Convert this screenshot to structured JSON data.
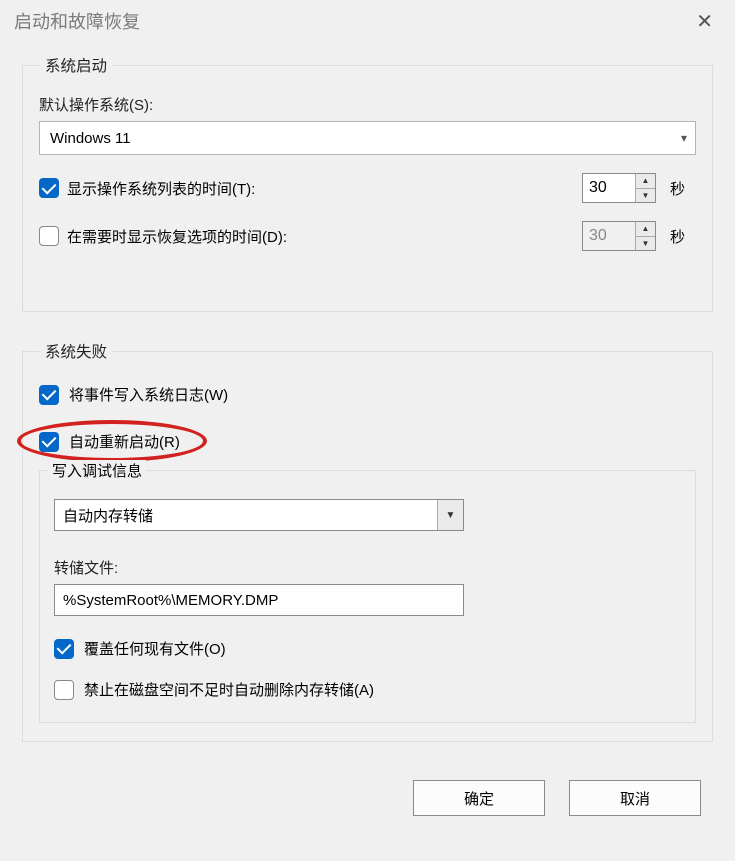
{
  "window": {
    "title": "启动和故障恢复"
  },
  "startup": {
    "legend": "系统启动",
    "default_os_label": "默认操作系统(S):",
    "default_os_value": "Windows 11",
    "show_list_label": "显示操作系统列表的时间(T):",
    "show_list_checked": true,
    "show_list_seconds": "30",
    "unit": "秒",
    "show_recovery_label": "在需要时显示恢复选项的时间(D):",
    "show_recovery_checked": false,
    "show_recovery_seconds": "30"
  },
  "failure": {
    "legend": "系统失败",
    "write_log_label": "将事件写入系统日志(W)",
    "write_log_checked": true,
    "auto_restart_label": "自动重新启动(R)",
    "auto_restart_checked": true,
    "debug_legend": "写入调试信息",
    "dump_type": "自动内存转储",
    "dump_file_label": "转储文件:",
    "dump_file_value": "%SystemRoot%\\MEMORY.DMP",
    "overwrite_label": "覆盖任何现有文件(O)",
    "overwrite_checked": true,
    "nodelete_label": "禁止在磁盘空间不足时自动删除内存转储(A)",
    "nodelete_checked": false
  },
  "buttons": {
    "ok": "确定",
    "cancel": "取消"
  }
}
